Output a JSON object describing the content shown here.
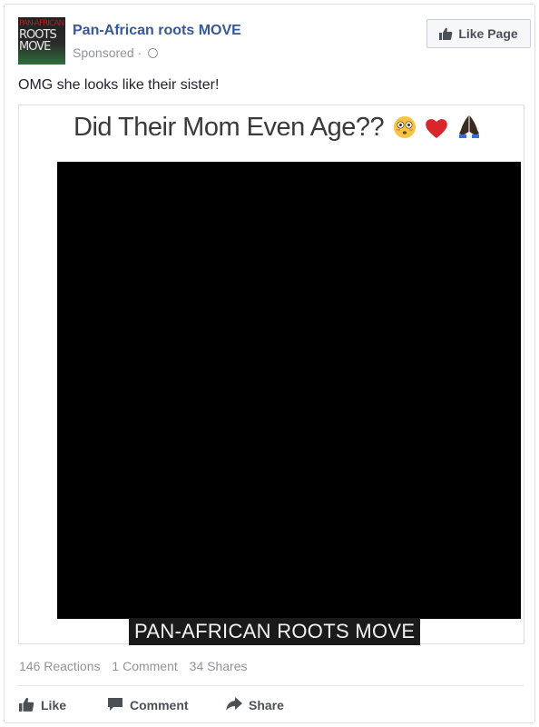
{
  "post": {
    "page_name": "Pan-African roots MOVE",
    "sponsored_label": "Sponsored ·",
    "like_page_label": "Like Page",
    "text": "OMG she looks like their sister!",
    "avatar_text": [
      "PAN-AFRICAN",
      "ROOTS",
      "MOVE"
    ]
  },
  "image": {
    "headline": "Did Their Mom Even Age??",
    "headline_emojis": [
      "flushed-face",
      "red-heart",
      "folded-hands"
    ],
    "watermark": "PAN-AFRICAN ROOTS MOVE"
  },
  "stats": {
    "reactions": "146 Reactions",
    "comments": "1 Comment",
    "shares": "34 Shares"
  },
  "actions": {
    "like": "Like",
    "comment": "Comment",
    "share": "Share"
  },
  "colors": {
    "link_blue": "#365899",
    "muted_text": "#90949c",
    "action_text": "#4b4f56"
  }
}
